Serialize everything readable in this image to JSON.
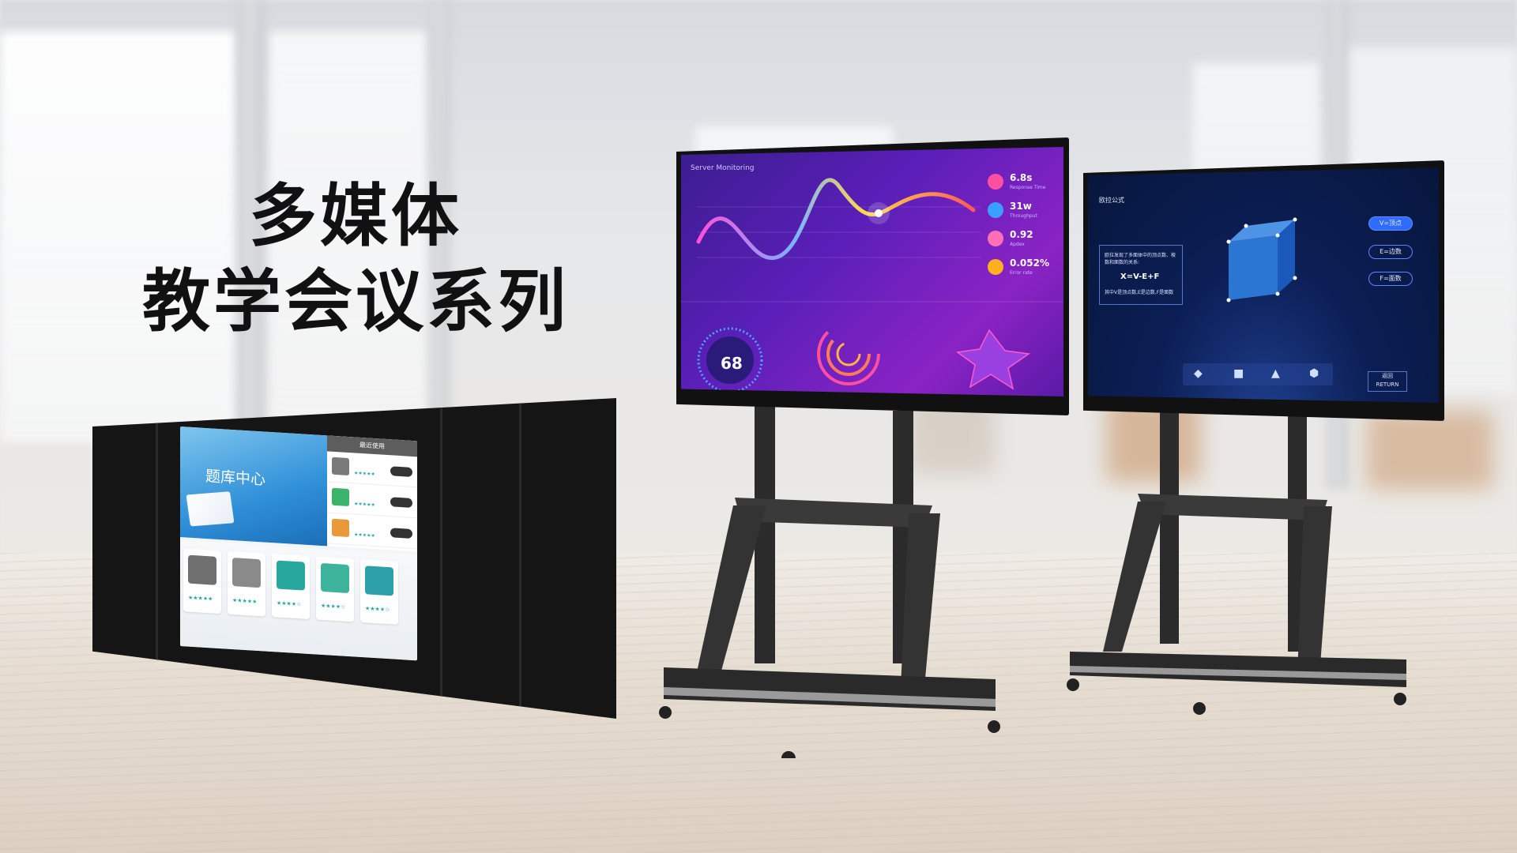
{
  "headline": {
    "line1": "多媒体",
    "line2": "教学会议系列"
  },
  "blackboard": {
    "hero_title": "题库中心",
    "side_header": "最近使用"
  },
  "monitor_left": {
    "title": "Server Monitoring",
    "stats": [
      {
        "value": "6.8s",
        "label": "Response Time",
        "color": "#ff4fa0"
      },
      {
        "value": "31w",
        "label": "Throughput",
        "color": "#3aa0ff"
      },
      {
        "value": "0.92",
        "label": "Apdex",
        "color": "#ff6fb5"
      },
      {
        "value": "0.052%",
        "label": "Error rate",
        "color": "#ffb020"
      }
    ],
    "gauge_value": "68"
  },
  "monitor_right": {
    "tag": "欧拉公式",
    "question": "欧拉发现了多面体中的顶点数、棱数和面数的关系:",
    "formula": "X=V-E+F",
    "note": "其中V是顶点数,E是边数,F是面数",
    "buttons": [
      "V=顶点",
      "E=边数",
      "F=面数"
    ],
    "return_cn": "返回",
    "return_en": "RETURN"
  },
  "colors": {
    "monitor_left_bg": "#5a1fb8",
    "monitor_right_bg": "#0c1f55",
    "accent_teal": "#2aa6a0"
  }
}
